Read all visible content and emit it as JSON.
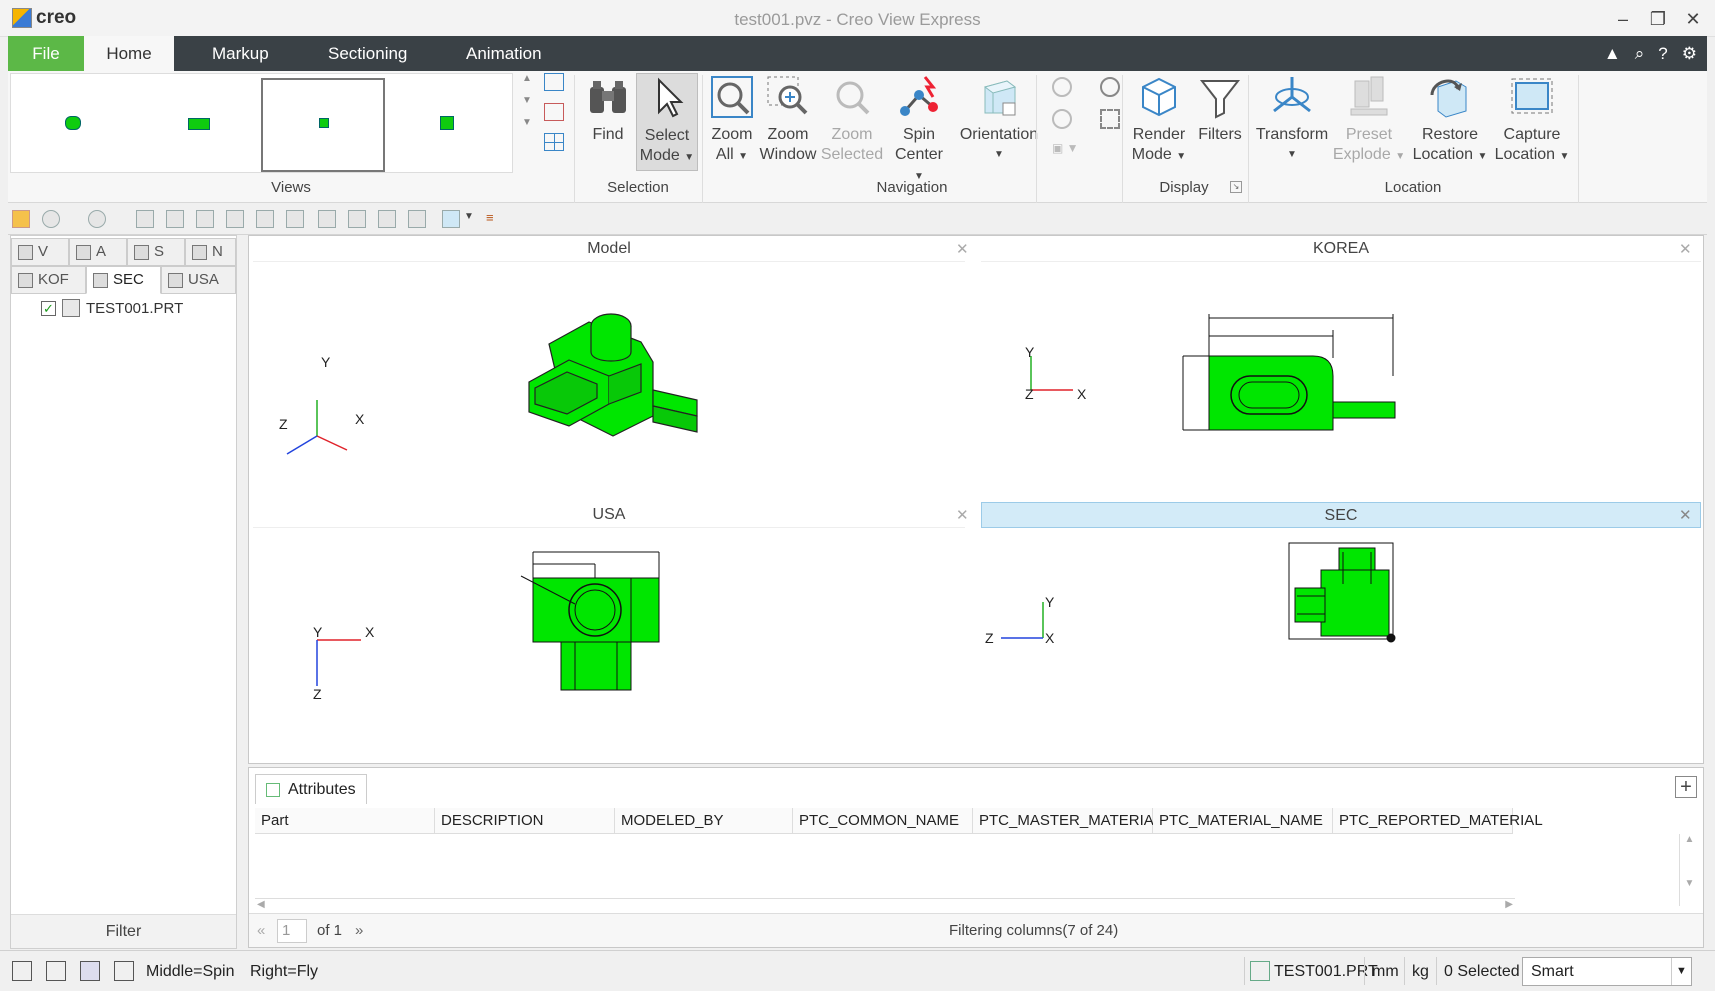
{
  "app": {
    "logo_text": "creo",
    "window_title": "test001.pvz - Creo View Express",
    "controls": [
      "–",
      "❐",
      "✕"
    ]
  },
  "tabs": [
    "File",
    "Home",
    "Markup",
    "Sectioning",
    "Animation"
  ],
  "tabbar_icons": [
    "▲",
    "⌕",
    "?",
    "⚙"
  ],
  "ribbon": {
    "groups": {
      "views": "Views",
      "selection": "Selection",
      "navigation": "Navigation",
      "display": "Display",
      "location": "Location"
    },
    "find": "Find",
    "select_mode": [
      "Select",
      "Mode"
    ],
    "zoom_all": [
      "Zoom",
      "All"
    ],
    "zoom_window": [
      "Zoom",
      "Window"
    ],
    "zoom_selected": [
      "Zoom",
      "Selected"
    ],
    "spin_center": [
      "Spin",
      "Center"
    ],
    "orientation": "Orientation",
    "render_mode": [
      "Render",
      "Mode"
    ],
    "filters": "Filters",
    "transform": "Transform",
    "preset_explode": [
      "Preset",
      "Explode"
    ],
    "restore_location": [
      "Restore",
      "Location"
    ],
    "capture_location": [
      "Capture",
      "Location"
    ]
  },
  "left_panel": {
    "tabs_row1": [
      "V",
      "A",
      "S",
      "N"
    ],
    "tabs_row2": [
      "KOF",
      "SEC",
      "USA"
    ],
    "tree_item": "TEST001.PRT",
    "filter": "Filter"
  },
  "viewports": [
    {
      "title": "Model",
      "axes": [
        "Y",
        "Z",
        "X"
      ]
    },
    {
      "title": "KOREA",
      "axes": [
        "Y",
        "Z",
        "X"
      ]
    },
    {
      "title": "USA",
      "axes": [
        "Y",
        "X",
        "Z"
      ]
    },
    {
      "title": "SEC",
      "axes": [
        "Y",
        "Z",
        "X"
      ]
    }
  ],
  "attributes": {
    "tab": "Attributes",
    "columns": [
      "Part",
      "DESCRIPTION",
      "MODELED_BY",
      "PTC_COMMON_NAME",
      "PTC_MASTER_MATERIAL",
      "PTC_MATERIAL_NAME",
      "PTC_REPORTED_MATERIAL"
    ],
    "page_value": "1",
    "page_of": "of 1",
    "filter_status": "Filtering columns(7 of 24)"
  },
  "status": {
    "mouse_middle": "Middle=Spin",
    "mouse_right": "Right=Fly",
    "selected_part": "TEST001.PRT",
    "unit_length": "mm",
    "unit_mass": "kg",
    "selected_count": "0 Selected",
    "pick_mode": "Smart"
  },
  "colors": {
    "model_green": "#00e600",
    "file_tab": "#5cb847",
    "tabbar": "#3a4146",
    "active_viewport": "#d3ebf8",
    "axis_x": "#e0222a",
    "axis_y": "#22b022",
    "axis_z": "#2244dd"
  }
}
